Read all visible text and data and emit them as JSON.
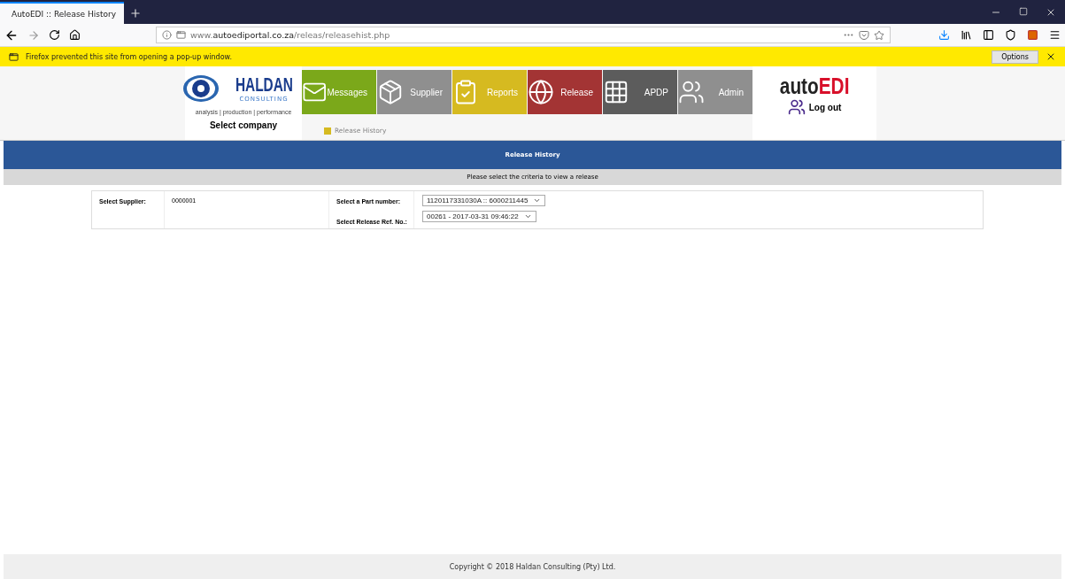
{
  "browser": {
    "tab": {
      "title": "AutoEDI :: Release History",
      "selected": true
    },
    "address": "www.**autoediportal.co.za**/releas/releasehist.php",
    "notification": {
      "text": "Firefox prevented this site from opening a pop-up window.",
      "button": "Options"
    }
  },
  "header": {
    "logo": {
      "name": "HALDAN",
      "sub": "CONSULTING",
      "tagline": "analysis | production | performance"
    },
    "company_label": "Select company",
    "menu": [
      {
        "label": "Messages",
        "color": "#7ba81a"
      },
      {
        "label": "Supplier",
        "color": "#8f8f8f"
      },
      {
        "label": "Reports",
        "color": "#d6ba20"
      },
      {
        "label": "Release",
        "color": "#a33434"
      },
      {
        "label": "APDP",
        "color": "#5c5c5c"
      },
      {
        "label": "Admin",
        "color": "#8f8f8f"
      }
    ],
    "breadcrumb": "Release History",
    "brand": {
      "left": "auto",
      "right": "EDI"
    },
    "logout": "Log out"
  },
  "title_bar": "Release History",
  "instruction": "Please select the criteria to view a release",
  "form": {
    "supplier_label": "Select Supplier:",
    "supplier_value": "0000001",
    "fields": [
      {
        "label": "Select a Part number:",
        "value": "1120117331030A :: 6000211445"
      },
      {
        "label": "Select Release Ref. No.:",
        "value": "00261 - 2017-03-31 09:46:22"
      }
    ]
  },
  "footer": "Copyright © 2018 Haldan Consulting (Pty) Ltd."
}
